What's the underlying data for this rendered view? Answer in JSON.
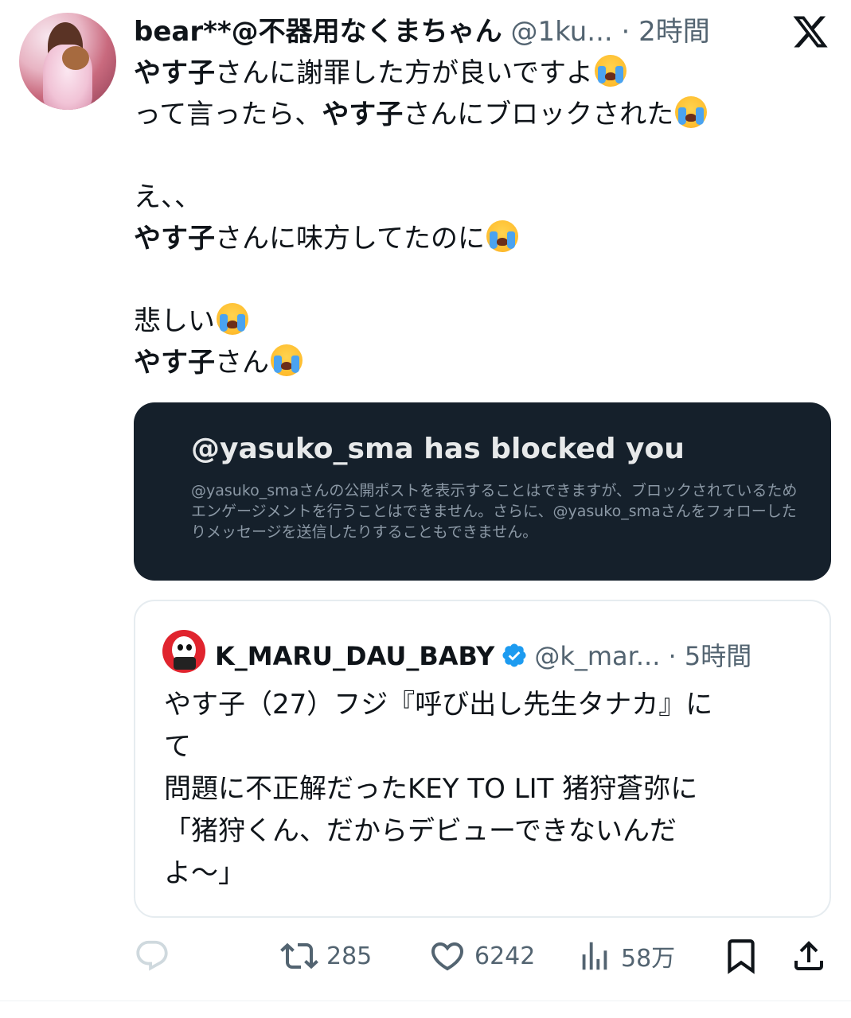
{
  "post": {
    "author_name": "bear**@不器用なくまちゃん",
    "handle": "@1ku...",
    "separator": "·",
    "time": "2時間",
    "body_lines": [
      {
        "bold": "やす子",
        "text": "さんに謝罪した方が良いですよ",
        "emoji": true
      },
      {
        "pre": "って言ったら、",
        "bold": "やす子",
        "text": "さんにブロックされた",
        "emoji": true
      },
      {
        "pre": ""
      },
      {
        "pre": "え、、"
      },
      {
        "bold": "やす子",
        "text": "さんに味方してたのに",
        "emoji": true
      },
      {
        "pre": ""
      },
      {
        "pre": "悲しい",
        "emoji": true
      },
      {
        "bold": "やす子",
        "text": "さん",
        "emoji": true
      }
    ]
  },
  "blocked_notice": {
    "title": "@yasuko_sma has blocked you",
    "body": "@yasuko_smaさんの公開ポストを表示することはできますが、ブロックされているためエンゲージメントを行うことはできません。さらに、@yasuko_smaさんをフォローしたりメッセージを送信したりすることもできません。"
  },
  "quoted_post": {
    "author_name": "K_MARU_DAU_BABY",
    "handle": "@k_mar...",
    "separator": "·",
    "time": "5時間",
    "body_lines": [
      "やす子（27）フジ『呼び出し先生タナカ』に",
      "て",
      "問題に不正解だったKEY TO LIT 猪狩蒼弥に",
      "「猪狩くん、だからデビューできないんだ",
      "よ〜」"
    ]
  },
  "actions": {
    "reply_count": "",
    "retweet_count": "285",
    "like_count": "6242",
    "view_count": "58万"
  },
  "icons": {
    "platform": "x-logo-icon",
    "verified": "verified-badge-icon",
    "reply": "reply-icon",
    "retweet": "retweet-icon",
    "like": "heart-icon",
    "views": "views-icon",
    "bookmark": "bookmark-icon",
    "share": "share-icon"
  },
  "colors": {
    "text": "#0f1419",
    "muted": "#536471",
    "verified": "#1d9bf0",
    "card_bg": "#15202b",
    "card_title": "#e7e9ea",
    "card_body": "#8b98a5"
  }
}
